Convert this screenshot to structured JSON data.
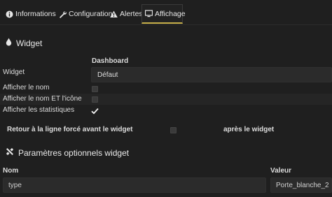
{
  "tabs": [
    {
      "label": "Informations",
      "icon": "info-circle-icon"
    },
    {
      "label": "Configuration",
      "icon": "wrench-icon"
    },
    {
      "label": "Alertes",
      "icon": "warning-icon"
    },
    {
      "label": "Affichage",
      "icon": "monitor-icon",
      "active": true
    }
  ],
  "widget_section": {
    "title": "Widget",
    "icon": "drop-icon",
    "dashboard_header": "Dashboard",
    "widget_label": "Widget",
    "widget_value": "Défaut",
    "options": [
      {
        "label": "Afficher le nom",
        "checked": false
      },
      {
        "label": "Afficher le nom ET l'icône",
        "checked": false
      },
      {
        "label": "Afficher les statistiques",
        "checked": true
      }
    ],
    "line_break_label": "Retour à la ligne forcé avant le widget",
    "line_break_checked": false,
    "after_label": "après le widget"
  },
  "params_section": {
    "title": "Paramètres optionnels widget",
    "icon": "tools-icon",
    "name_header": "Nom",
    "value_header": "Valeur",
    "rows": [
      {
        "name": "type",
        "value": "Porte_blanche_2"
      }
    ]
  },
  "colors": {
    "background": "#1f1f1f",
    "active_tab_underline": "#c8b14a",
    "input_bg": "#2b2b2b"
  }
}
